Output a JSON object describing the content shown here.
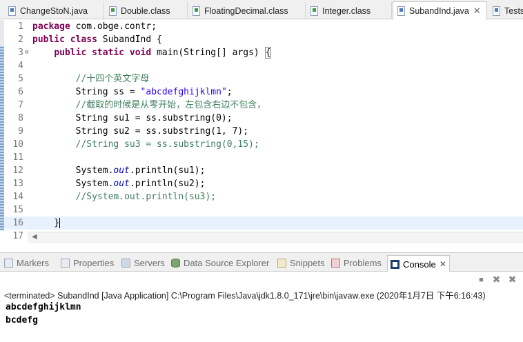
{
  "editor_tabs": [
    {
      "label": "ChangeStoN.java",
      "type": "java"
    },
    {
      "label": "Double.class",
      "type": "class"
    },
    {
      "label": "FloatingDecimal.class",
      "type": "class"
    },
    {
      "label": "Integer.class",
      "type": "class"
    },
    {
      "label": "SubandInd.java",
      "type": "java",
      "active": true
    },
    {
      "label": "Tests",
      "type": "java"
    }
  ],
  "editor": {
    "line_numbers": [
      "1",
      "2",
      "3",
      "4",
      "5",
      "6",
      "7",
      "8",
      "9",
      "10",
      "11",
      "12",
      "13",
      "14",
      "15",
      "16",
      "17"
    ],
    "lines": [
      [
        {
          "t": "package",
          "c": "kw"
        },
        {
          "t": " com.obge.contr;"
        }
      ],
      [
        {
          "t": "public",
          "c": "kw"
        },
        {
          "t": " "
        },
        {
          "t": "class",
          "c": "kw"
        },
        {
          "t": " SubandInd {"
        }
      ],
      [
        {
          "t": "    "
        },
        {
          "t": "public",
          "c": "kw"
        },
        {
          "t": " "
        },
        {
          "t": "static",
          "c": "kw"
        },
        {
          "t": " "
        },
        {
          "t": "void",
          "c": "kw"
        },
        {
          "t": " main(String[] args) "
        },
        {
          "t": "{",
          "c": "bk"
        }
      ],
      [],
      [
        {
          "t": "        "
        },
        {
          "t": "//十四个英文字母",
          "c": "cm"
        }
      ],
      [
        {
          "t": "        String ss = "
        },
        {
          "t": "\"abcdefghijklmn\"",
          "c": "str"
        },
        {
          "t": ";"
        }
      ],
      [
        {
          "t": "        "
        },
        {
          "t": "//截取的时候是从零开始，左包含右边不包含，",
          "c": "cm"
        }
      ],
      [
        {
          "t": "        String su1 = ss.substring(0);"
        }
      ],
      [
        {
          "t": "        String su2 = ss.substring(1, 7);"
        }
      ],
      [
        {
          "t": "        "
        },
        {
          "t": "//String su3 = ss.substring(0,15);",
          "c": "cm"
        }
      ],
      [],
      [
        {
          "t": "        System."
        },
        {
          "t": "out",
          "c": "fld"
        },
        {
          "t": ".println(su1);"
        }
      ],
      [
        {
          "t": "        System."
        },
        {
          "t": "out",
          "c": "fld"
        },
        {
          "t": ".println(su2);"
        }
      ],
      [
        {
          "t": "        "
        },
        {
          "t": "//System.out.println(su3);",
          "c": "cm"
        }
      ],
      [],
      [
        {
          "t": "    }"
        },
        {
          "t": "",
          "c": "caret"
        }
      ],
      []
    ]
  },
  "bottom_tabs": [
    {
      "label": "Markers",
      "icon": "markers-icon"
    },
    {
      "label": "Properties",
      "icon": "properties-icon"
    },
    {
      "label": "Servers",
      "icon": "servers-icon"
    },
    {
      "label": "Data Source Explorer",
      "icon": "database-icon"
    },
    {
      "label": "Snippets",
      "icon": "snippets-icon"
    },
    {
      "label": "Problems",
      "icon": "problems-icon"
    },
    {
      "label": "Console",
      "icon": "console-icon",
      "active": true
    }
  ],
  "console": {
    "status": "<terminated> SubandInd [Java Application] C:\\Program Files\\Java\\jdk1.8.0_171\\jre\\bin\\javaw.exe (2020年1月7日 下午6:16:43)",
    "output": [
      "abcdefghijklmn",
      "bcdefg"
    ],
    "close_glyph": "✕",
    "toolbar_glyphs": {
      "stop": "■",
      "remove": "✖",
      "remove_all": "✖"
    }
  }
}
